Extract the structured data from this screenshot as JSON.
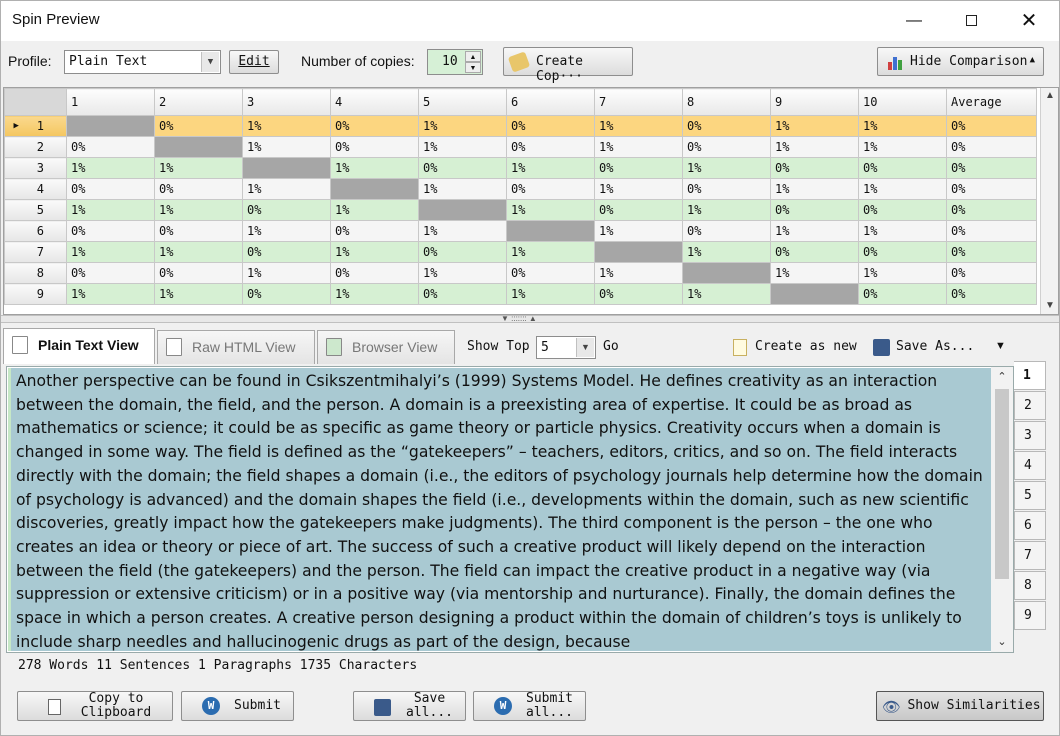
{
  "window": {
    "title": "Spin Preview"
  },
  "toolbar": {
    "profile_label": "Profile:",
    "profile_value": "Plain Text",
    "edit_label": "Edit",
    "copies_label": "Number of copies:",
    "copies_value": "10",
    "create_label": "Create Cop···",
    "hide_label": "Hide Comparison"
  },
  "grid": {
    "columns": [
      "1",
      "2",
      "3",
      "4",
      "5",
      "6",
      "7",
      "8",
      "9",
      "10",
      "Average"
    ],
    "rows": [
      {
        "label": "1",
        "cells": [
          "",
          "0%",
          "1%",
          "0%",
          "1%",
          "0%",
          "1%",
          "0%",
          "1%",
          "1%",
          "0%"
        ]
      },
      {
        "label": "2",
        "cells": [
          "0%",
          "",
          "1%",
          "0%",
          "1%",
          "0%",
          "1%",
          "0%",
          "1%",
          "1%",
          "0%"
        ]
      },
      {
        "label": "3",
        "cells": [
          "1%",
          "1%",
          "",
          "1%",
          "0%",
          "1%",
          "0%",
          "1%",
          "0%",
          "0%",
          "0%"
        ]
      },
      {
        "label": "4",
        "cells": [
          "0%",
          "0%",
          "1%",
          "",
          "1%",
          "0%",
          "1%",
          "0%",
          "1%",
          "1%",
          "0%"
        ]
      },
      {
        "label": "5",
        "cells": [
          "1%",
          "1%",
          "0%",
          "1%",
          "",
          "1%",
          "0%",
          "1%",
          "0%",
          "0%",
          "0%"
        ]
      },
      {
        "label": "6",
        "cells": [
          "0%",
          "0%",
          "1%",
          "0%",
          "1%",
          "",
          "1%",
          "0%",
          "1%",
          "1%",
          "0%"
        ]
      },
      {
        "label": "7",
        "cells": [
          "1%",
          "1%",
          "0%",
          "1%",
          "0%",
          "1%",
          "",
          "1%",
          "0%",
          "0%",
          "0%"
        ]
      },
      {
        "label": "8",
        "cells": [
          "0%",
          "0%",
          "1%",
          "0%",
          "1%",
          "0%",
          "1%",
          "",
          "1%",
          "1%",
          "0%"
        ]
      },
      {
        "label": "9",
        "cells": [
          "1%",
          "1%",
          "0%",
          "1%",
          "0%",
          "1%",
          "0%",
          "1%",
          "",
          "0%",
          "0%"
        ]
      }
    ]
  },
  "tabs": [
    {
      "label": "Plain Text View"
    },
    {
      "label": "Raw HTML View"
    },
    {
      "label": "Browser View"
    }
  ],
  "viewbar": {
    "show_top_label": "Show Top",
    "show_top_value": "5",
    "go_label": "Go",
    "create_new_label": "Create as new",
    "save_as_label": "Save As..."
  },
  "text": "Another perspective can be found in Csikszentmihalyi’s (1999) Systems Model. He defines creativity as an interaction between the domain, the field, and the person. A domain is a preexisting area of expertise. It could be as broad as mathematics or science; it could be as specific as game theory or particle physics. Creativity occurs when a domain is changed in some way. The field is defined as the “gatekeepers” – teachers, editors, critics, and so on. The field interacts directly with the domain; the field shapes a domain (i.e., the editors of psychology journals help determine how the domain of psychology is advanced) and the domain shapes the field (i.e., developments within the domain, such as new scientific discoveries, greatly impact how the gatekeepers make judgments). The third component is the person – the one who creates an idea or theory or piece of art. The success of such a creative product will likely depend on the interaction between the field (the gatekeepers) and the person. The field can impact the creative product in a negative way (via suppression or extensive criticism) or in a positive way (via mentorship and nurturance). Finally, the domain defines the space in which a person creates. A creative person designing a product within the domain of children’s toys is unlikely to include sharp needles and hallucinogenic drugs as part of the design, because",
  "copy_numbers": [
    "1",
    "2",
    "3",
    "4",
    "5",
    "6",
    "7",
    "8",
    "9"
  ],
  "status": "278 Words 11 Sentences 1 Paragraphs 1735 Characters",
  "bottom": {
    "copy_label": "Copy to Clipboard",
    "submit_label": "Submit",
    "save_all_label": "Save all...",
    "submit_all_label": "Submit all...",
    "show_sim_label": "Show Similarities"
  }
}
